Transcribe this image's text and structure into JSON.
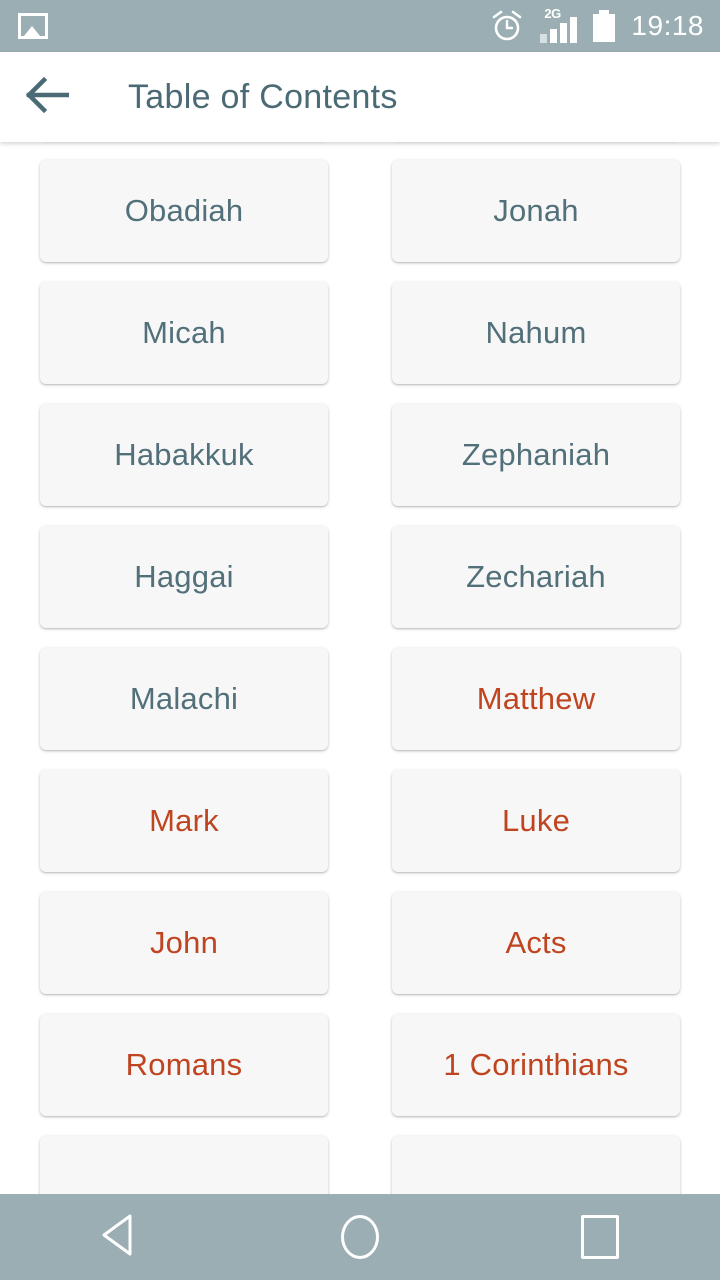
{
  "status_bar": {
    "photo_icon": "photo-icon",
    "alarm_icon": "alarm-clock-icon",
    "network_type": "2G",
    "signal_icon": "signal-bars-icon",
    "battery_icon": "battery-icon",
    "time": "19:18",
    "background_color": "#9aaeb3"
  },
  "app_bar": {
    "back_icon": "back-arrow-icon",
    "title": "Table of Contents",
    "title_color": "#4a6b75",
    "background_color": "#ffffff"
  },
  "grid": {
    "columns": 2,
    "card_background": "#f7f7f7",
    "old_testament_color": "#52707a",
    "new_testament_color": "#bf4520",
    "items": [
      {
        "label": "",
        "testament": "ot",
        "partial": true
      },
      {
        "label": "",
        "testament": "ot",
        "partial": true
      },
      {
        "label": "Obadiah",
        "testament": "ot",
        "partial": false
      },
      {
        "label": "Jonah",
        "testament": "ot",
        "partial": false
      },
      {
        "label": "Micah",
        "testament": "ot",
        "partial": false
      },
      {
        "label": "Nahum",
        "testament": "ot",
        "partial": false
      },
      {
        "label": "Habakkuk",
        "testament": "ot",
        "partial": false
      },
      {
        "label": "Zephaniah",
        "testament": "ot",
        "partial": false
      },
      {
        "label": "Haggai",
        "testament": "ot",
        "partial": false
      },
      {
        "label": "Zechariah",
        "testament": "ot",
        "partial": false
      },
      {
        "label": "Malachi",
        "testament": "ot",
        "partial": false
      },
      {
        "label": "Matthew",
        "testament": "nt",
        "partial": false
      },
      {
        "label": "Mark",
        "testament": "nt",
        "partial": false
      },
      {
        "label": "Luke",
        "testament": "nt",
        "partial": false
      },
      {
        "label": "John",
        "testament": "nt",
        "partial": false
      },
      {
        "label": "Acts",
        "testament": "nt",
        "partial": false
      },
      {
        "label": "Romans",
        "testament": "nt",
        "partial": false
      },
      {
        "label": "1 Corinthians",
        "testament": "nt",
        "partial": false
      },
      {
        "label": "",
        "testament": "nt",
        "partial": true
      },
      {
        "label": "",
        "testament": "nt",
        "partial": true
      }
    ]
  },
  "nav_bar": {
    "back_icon": "nav-back-triangle-icon",
    "home_icon": "nav-home-circle-icon",
    "recents_icon": "nav-recents-square-icon",
    "background_color": "#9aaeb3"
  }
}
